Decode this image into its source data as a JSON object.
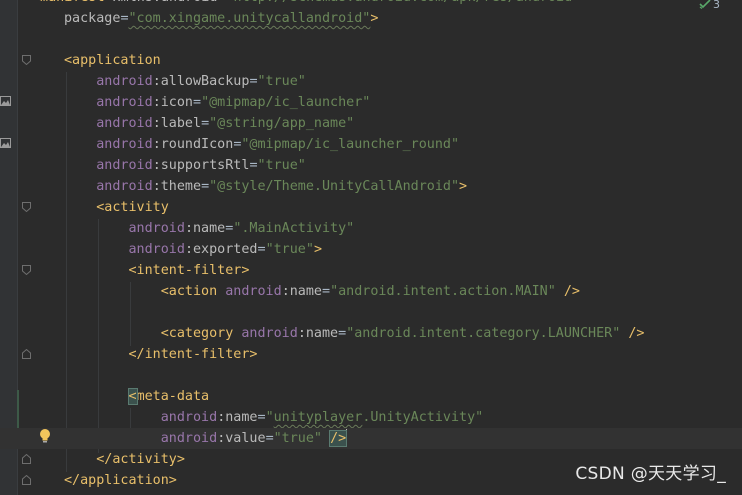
{
  "editor": {
    "lines": [
      {
        "id": "l0",
        "segments": [
          [
            "tag",
            "<manifest "
          ],
          [
            "attr",
            "xmlns:android"
          ],
          [
            "plain",
            "="
          ],
          [
            "val",
            "\"http://schemas.android.com/apk/res/android\""
          ]
        ]
      },
      {
        "id": "l1",
        "segments": [
          [
            "plain",
            "    "
          ],
          [
            "attr",
            "package"
          ],
          [
            "plain",
            "="
          ],
          [
            "val",
            "\"com.xingame.unitycallandroid\""
          ],
          [
            "tag",
            ">"
          ]
        ]
      },
      {
        "id": "l2",
        "segments": []
      },
      {
        "id": "l3",
        "segments": [
          [
            "plain",
            "    "
          ],
          [
            "tag",
            "<application"
          ]
        ]
      },
      {
        "id": "l4",
        "segments": [
          [
            "plain",
            "        "
          ],
          [
            "attr-ns",
            "android"
          ],
          [
            "attr",
            ":allowBackup"
          ],
          [
            "plain",
            "="
          ],
          [
            "val",
            "\"true\""
          ]
        ]
      },
      {
        "id": "l5",
        "segments": [
          [
            "plain",
            "        "
          ],
          [
            "attr-ns",
            "android"
          ],
          [
            "attr",
            ":icon"
          ],
          [
            "plain",
            "="
          ],
          [
            "val",
            "\"@mipmap/ic_launcher\""
          ]
        ]
      },
      {
        "id": "l6",
        "segments": [
          [
            "plain",
            "        "
          ],
          [
            "attr-ns",
            "android"
          ],
          [
            "attr",
            ":label"
          ],
          [
            "plain",
            "="
          ],
          [
            "val",
            "\"@string/app_name\""
          ]
        ]
      },
      {
        "id": "l7",
        "segments": [
          [
            "plain",
            "        "
          ],
          [
            "attr-ns",
            "android"
          ],
          [
            "attr",
            ":roundIcon"
          ],
          [
            "plain",
            "="
          ],
          [
            "val",
            "\"@mipmap/ic_launcher_round\""
          ]
        ]
      },
      {
        "id": "l8",
        "segments": [
          [
            "plain",
            "        "
          ],
          [
            "attr-ns",
            "android"
          ],
          [
            "attr",
            ":supportsRtl"
          ],
          [
            "plain",
            "="
          ],
          [
            "val",
            "\"true\""
          ]
        ]
      },
      {
        "id": "l9",
        "segments": [
          [
            "plain",
            "        "
          ],
          [
            "attr-ns",
            "android"
          ],
          [
            "attr",
            ":theme"
          ],
          [
            "plain",
            "="
          ],
          [
            "val",
            "\"@style/Theme.UnityCallAndroid\""
          ],
          [
            "tag",
            ">"
          ]
        ]
      },
      {
        "id": "l10",
        "segments": [
          [
            "plain",
            "        "
          ],
          [
            "tag",
            "<activity"
          ]
        ]
      },
      {
        "id": "l11",
        "segments": [
          [
            "plain",
            "            "
          ],
          [
            "attr-ns",
            "android"
          ],
          [
            "attr",
            ":name"
          ],
          [
            "plain",
            "="
          ],
          [
            "val",
            "\".MainActivity\""
          ]
        ]
      },
      {
        "id": "l12",
        "segments": [
          [
            "plain",
            "            "
          ],
          [
            "attr-ns",
            "android"
          ],
          [
            "attr",
            ":exported"
          ],
          [
            "plain",
            "="
          ],
          [
            "val",
            "\"true\""
          ],
          [
            "tag",
            ">"
          ]
        ]
      },
      {
        "id": "l13",
        "segments": [
          [
            "plain",
            "            "
          ],
          [
            "tag",
            "<intent-filter>"
          ]
        ]
      },
      {
        "id": "l14",
        "segments": [
          [
            "plain",
            "                "
          ],
          [
            "tag",
            "<action "
          ],
          [
            "attr-ns",
            "android"
          ],
          [
            "attr",
            ":name"
          ],
          [
            "plain",
            "="
          ],
          [
            "val",
            "\"android.intent.action.MAIN\""
          ],
          [
            "tag",
            " />"
          ]
        ]
      },
      {
        "id": "l15",
        "segments": []
      },
      {
        "id": "l16",
        "segments": [
          [
            "plain",
            "                "
          ],
          [
            "tag",
            "<category "
          ],
          [
            "attr-ns",
            "android"
          ],
          [
            "attr",
            ":name"
          ],
          [
            "plain",
            "="
          ],
          [
            "val",
            "\"android.intent.category.LAUNCHER\""
          ],
          [
            "tag",
            " />"
          ]
        ]
      },
      {
        "id": "l17",
        "segments": [
          [
            "plain",
            "            "
          ],
          [
            "tag",
            "</intent-filter>"
          ]
        ]
      },
      {
        "id": "l18",
        "segments": []
      },
      {
        "id": "l19",
        "segments": [
          [
            "plain",
            "            "
          ],
          [
            "hl",
            "<"
          ],
          [
            "tag",
            "meta-data"
          ]
        ]
      },
      {
        "id": "l20",
        "segments": [
          [
            "plain",
            "                "
          ],
          [
            "attr-ns",
            "android"
          ],
          [
            "attr",
            ":name"
          ],
          [
            "plain",
            "="
          ],
          [
            "val",
            "\""
          ],
          [
            "valsq",
            "unityplayer"
          ],
          [
            "val",
            ".UnityActivity\""
          ]
        ]
      },
      {
        "id": "l21",
        "segments": [
          [
            "plain",
            "                "
          ],
          [
            "attr-ns",
            "android"
          ],
          [
            "attr",
            ":value"
          ],
          [
            "plain",
            "="
          ],
          [
            "val",
            "\"true\""
          ],
          [
            "plain",
            " "
          ],
          [
            "hltag",
            "/>"
          ],
          [
            "caret",
            ""
          ]
        ]
      },
      {
        "id": "l22",
        "segments": [
          [
            "plain",
            "        "
          ],
          [
            "tag",
            "</activity>"
          ]
        ]
      },
      {
        "id": "l23",
        "segments": [
          [
            "plain",
            "    "
          ],
          [
            "tag",
            "</application>"
          ]
        ]
      }
    ],
    "current_line": 21,
    "inspection_count": "3",
    "inspection_icon": "check-icon"
  },
  "watermark": {
    "text": "CSDN @天天学习_"
  },
  "colors": {
    "background": "#2b2b2b",
    "tag": "#e8bf6a",
    "attribute_namespace": "#9876aa",
    "attribute": "#bababa",
    "value": "#6a8759",
    "text": "#a9b7c6"
  }
}
